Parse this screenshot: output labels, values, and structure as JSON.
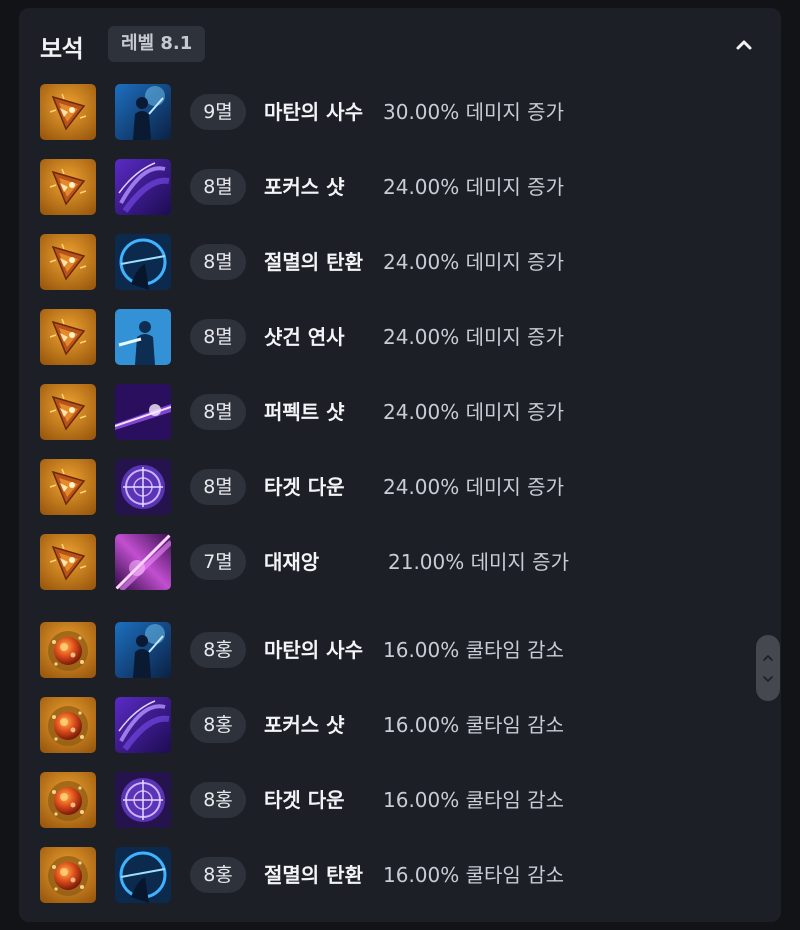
{
  "section": {
    "title": "보석",
    "level_badge": "레벨 8.1",
    "collapse_icon": "chevron-up-icon"
  },
  "gems": [
    {
      "gem_type": "damage",
      "skill_icon": "archer-silhouette",
      "grade": "9멸",
      "skill": "마탄의 사수",
      "effect": "30.00% 데미지 증가"
    },
    {
      "gem_type": "damage",
      "skill_icon": "purple-slash",
      "grade": "8멸",
      "skill": "포커스 샷",
      "effect": "24.00% 데미지 증가"
    },
    {
      "gem_type": "damage",
      "skill_icon": "blue-bow",
      "grade": "8멸",
      "skill": "절멸의 탄환",
      "effect": "24.00% 데미지 증가"
    },
    {
      "gem_type": "damage",
      "skill_icon": "blue-gunner",
      "grade": "8멸",
      "skill": "샷건 연사",
      "effect": "24.00% 데미지 증가"
    },
    {
      "gem_type": "damage",
      "skill_icon": "violet-beam",
      "grade": "8멸",
      "skill": "퍼펙트 샷",
      "effect": "24.00% 데미지 증가"
    },
    {
      "gem_type": "damage",
      "skill_icon": "crosshair-target",
      "grade": "8멸",
      "skill": "타겟 다운",
      "effect": "24.00% 데미지 증가"
    },
    {
      "gem_type": "damage",
      "skill_icon": "pink-burst",
      "grade": "7멸",
      "skill": "대재앙",
      "effect": "21.00% 데미지 증가"
    },
    {
      "gem_type": "cooldown",
      "skill_icon": "archer-silhouette",
      "grade": "8홍",
      "skill": "마탄의 사수",
      "effect": "16.00% 쿨타임 감소"
    },
    {
      "gem_type": "cooldown",
      "skill_icon": "purple-slash",
      "grade": "8홍",
      "skill": "포커스 샷",
      "effect": "16.00% 쿨타임 감소"
    },
    {
      "gem_type": "cooldown",
      "skill_icon": "crosshair-target",
      "grade": "8홍",
      "skill": "타겟 다운",
      "effect": "16.00% 쿨타임 감소"
    },
    {
      "gem_type": "cooldown",
      "skill_icon": "blue-bow",
      "grade": "8홍",
      "skill": "절멸의 탄환",
      "effect": "16.00% 쿨타임 감소"
    }
  ],
  "scrollbar_icons": [
    "chevron-up-icon",
    "chevron-down-icon"
  ]
}
